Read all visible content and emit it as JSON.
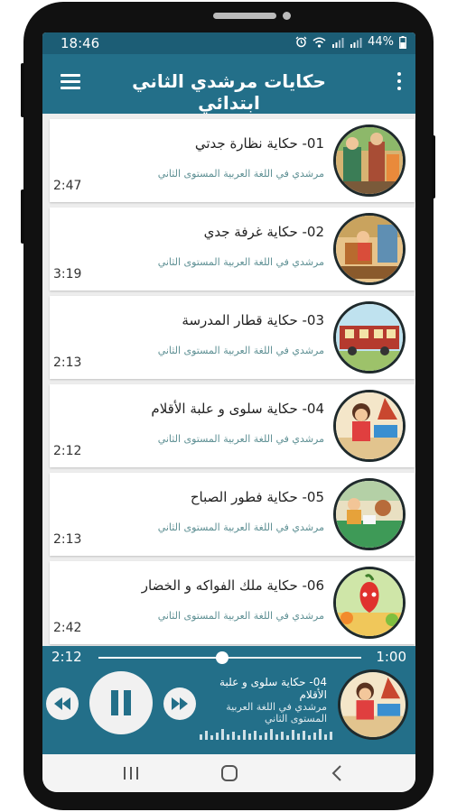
{
  "status": {
    "time": "18:46",
    "battery": "44%"
  },
  "appbar": {
    "title": "حكايات مرشدي الثاني ابتدائي"
  },
  "stories": [
    {
      "title": "01- حكاية نظارة جدتي",
      "subtitle": "مرشدي في اللغة العربية المستوى الثاني",
      "duration": "2:47"
    },
    {
      "title": "02- حكاية غرفة جدي",
      "subtitle": "مرشدي في اللغة العربية المستوى الثاني",
      "duration": "3:19"
    },
    {
      "title": "03- حكاية قطار المدرسة",
      "subtitle": "مرشدي في اللغة العربية المستوى الثاني",
      "duration": "2:13"
    },
    {
      "title": "04- حكاية سلوى و علبة الأقلام",
      "subtitle": "مرشدي في اللغة العربية المستوى الثاني",
      "duration": "2:12"
    },
    {
      "title": "05- حكاية فطور الصباح",
      "subtitle": "مرشدي في اللغة العربية المستوى الثاني",
      "duration": "2:13"
    },
    {
      "title": "06- حكاية ملك الفواكه و الخضار",
      "subtitle": "مرشدي في اللغة العربية المستوى الثاني",
      "duration": "2:42"
    }
  ],
  "player": {
    "elapsed": "2:12",
    "total": "1:00",
    "progress": 0.47,
    "title": "04- حكاية سلوى و علبة الأقلام",
    "subtitle": "مرشدي في اللغة العربية المستوى الثاني"
  },
  "icons": {
    "menu": "hamburger-icon",
    "more": "vertical-dots-icon",
    "prev": "rewind-icon",
    "play_pause": "pause-icon",
    "next": "fast-forward-icon"
  },
  "colors": {
    "appbar": "#236f89",
    "statusbar": "#1c5d75",
    "subtitle": "#5d8f93"
  }
}
